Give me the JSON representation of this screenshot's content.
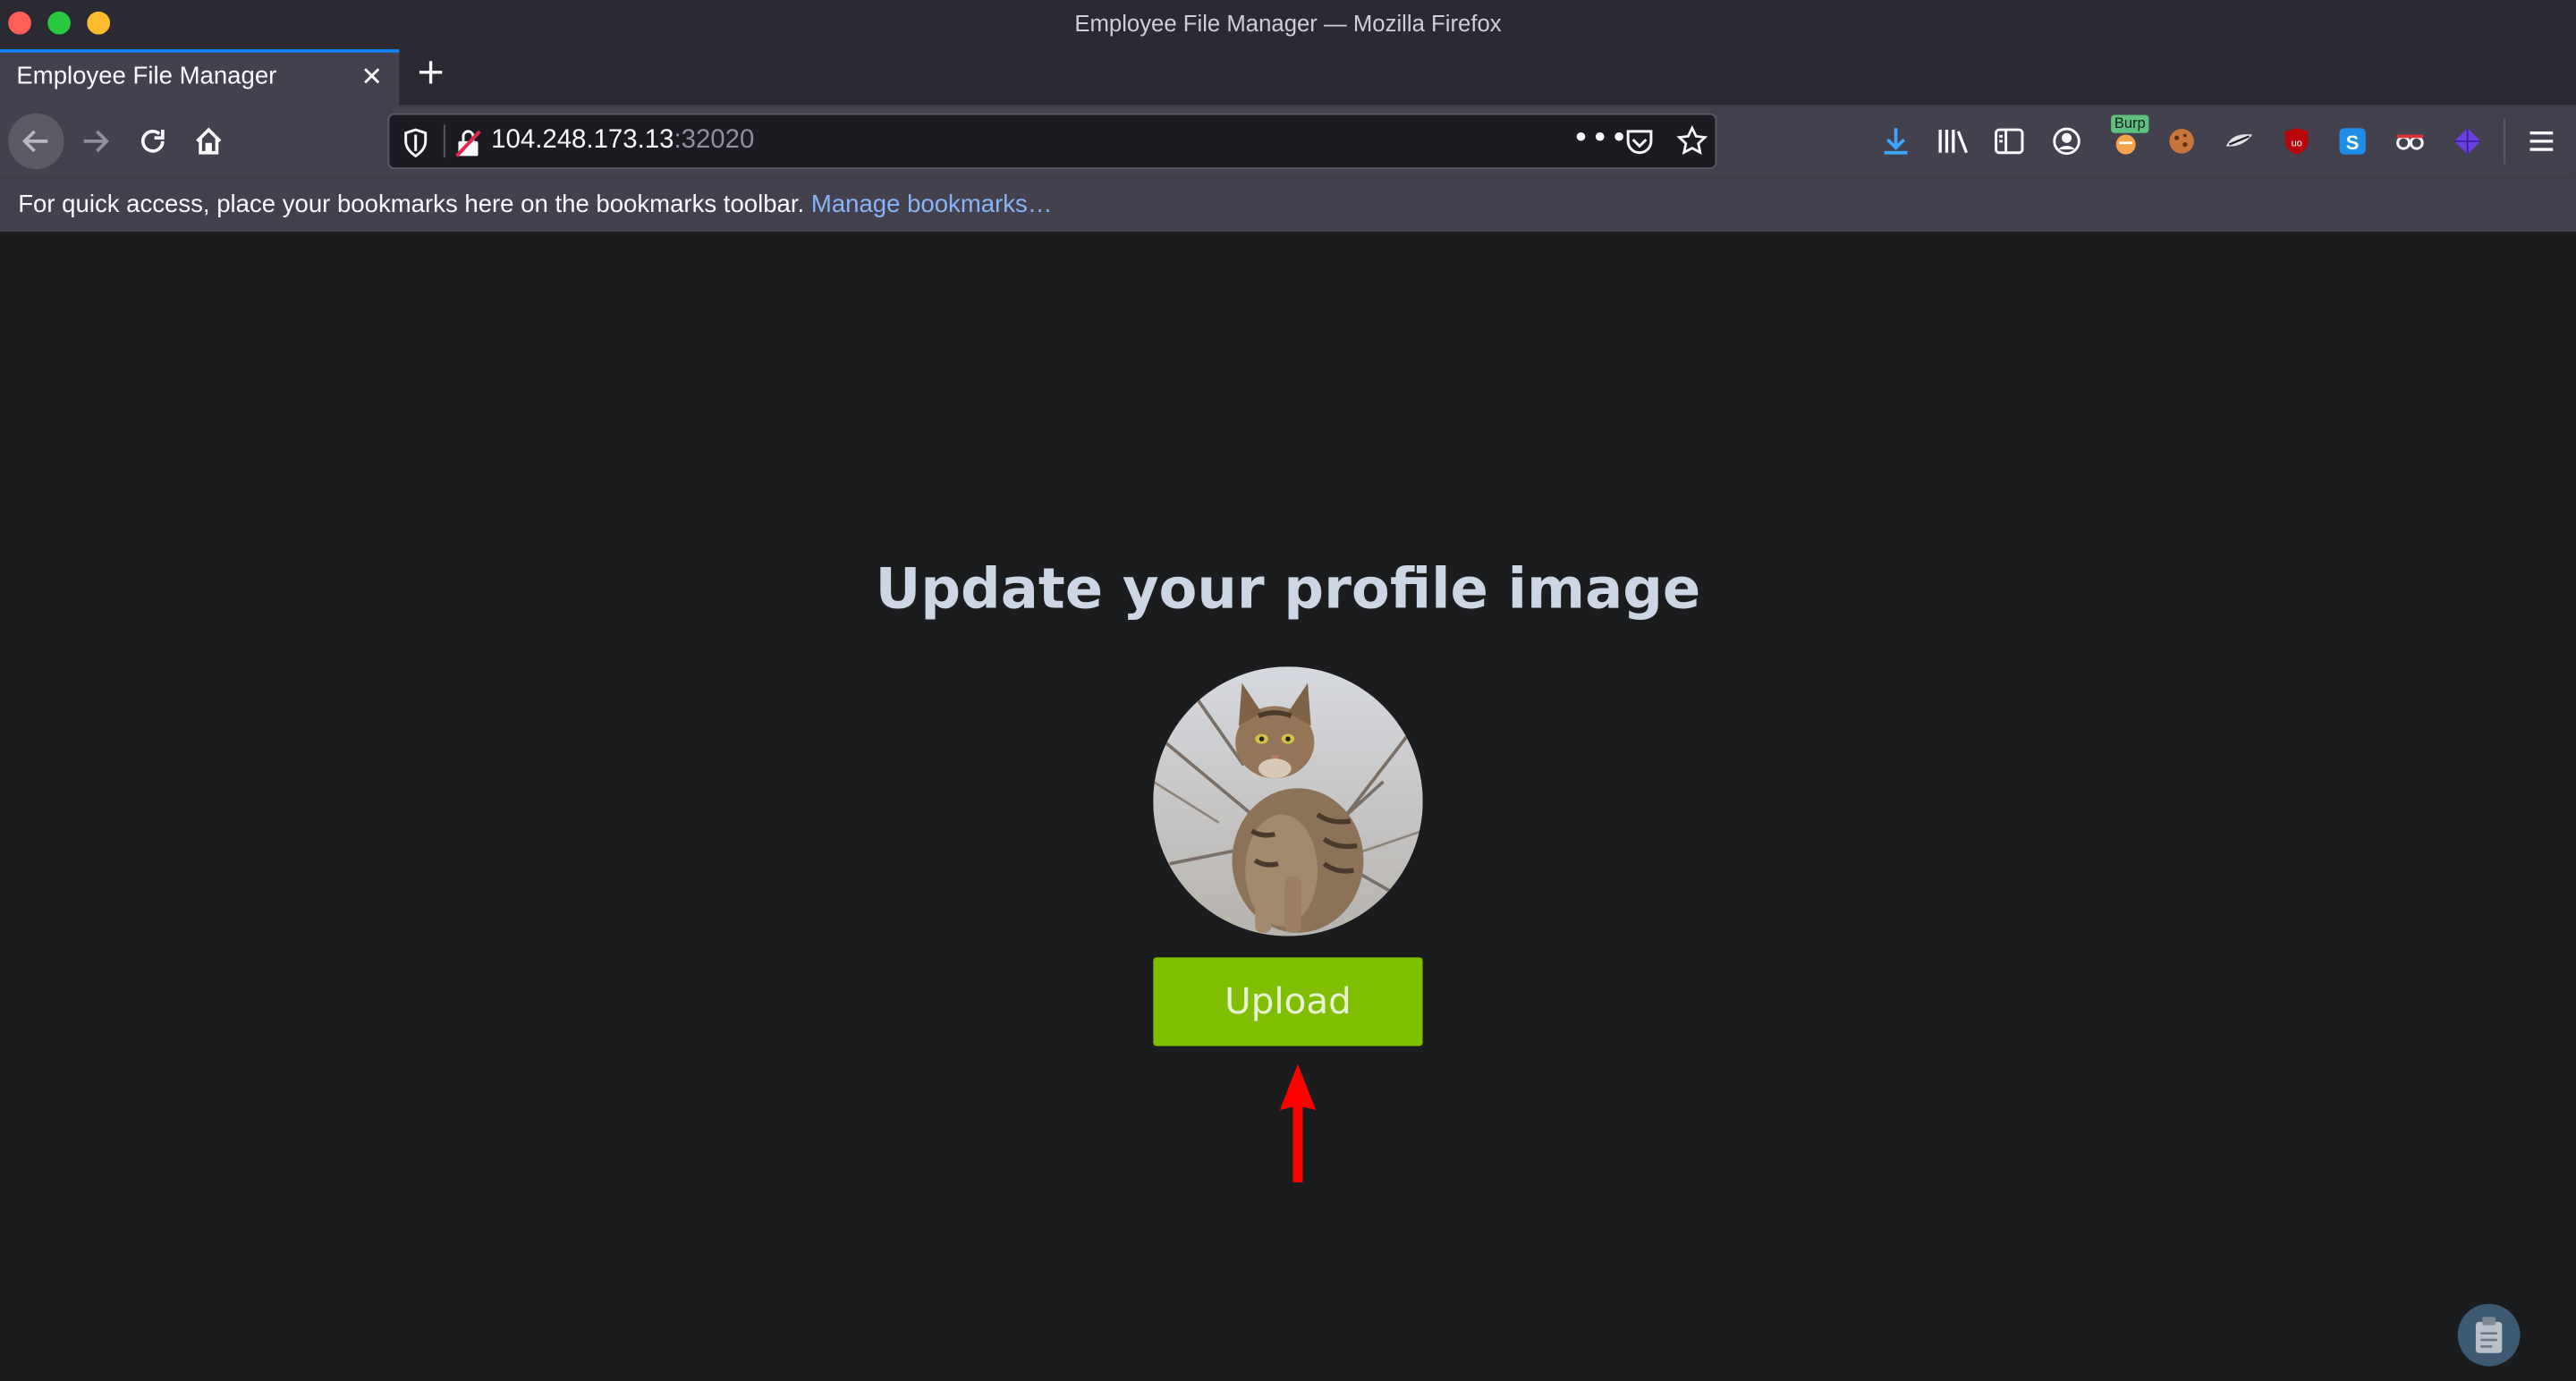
{
  "window": {
    "title": "Employee File Manager — Mozilla Firefox"
  },
  "tabs": [
    {
      "label": "Employee File Manager",
      "active": true
    }
  ],
  "toolbar": {
    "url_host": "104.248.173.13",
    "url_port": ":32020",
    "more_label": "•••",
    "extensions": [
      "download-icon",
      "library-icon",
      "sidebar-icon",
      "account-icon",
      "burp-icon",
      "cookie-icon",
      "extension-icon",
      "ublock-icon",
      "s-extension-icon",
      "spy-icon",
      "cube-icon",
      "menu-icon"
    ],
    "burp_badge": "Burp"
  },
  "bookmarks_bar": {
    "message": "For quick access, place your bookmarks here on the bookmarks toolbar.",
    "link": "Manage bookmarks…"
  },
  "page": {
    "heading": "Update your profile image",
    "upload_label": "Upload"
  },
  "colors": {
    "upload_button": "#7fbf00",
    "annotation_arrow": "#ff0000",
    "page_background": "#1b1c1e"
  }
}
